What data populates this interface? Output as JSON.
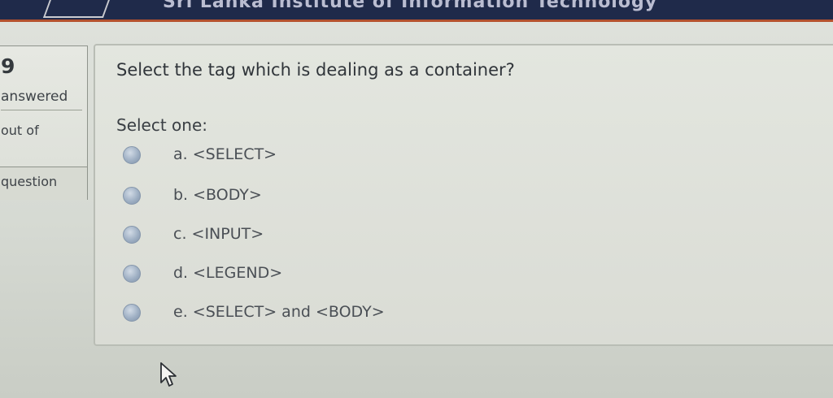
{
  "header": {
    "title": "Sri Lanka Institute of Information Technology"
  },
  "question_info": {
    "number": "9",
    "state": "answered",
    "mark": "out of",
    "flag_label": "question"
  },
  "question": {
    "text": "Select the tag which is dealing as a container?",
    "prompt": "Select one:",
    "options": [
      {
        "label": "a. <SELECT>"
      },
      {
        "label": "b. <BODY>"
      },
      {
        "label": "c. <INPUT>"
      },
      {
        "label": "d. <LEGEND>"
      },
      {
        "label": "e. <SELECT> and <BODY>"
      }
    ]
  }
}
